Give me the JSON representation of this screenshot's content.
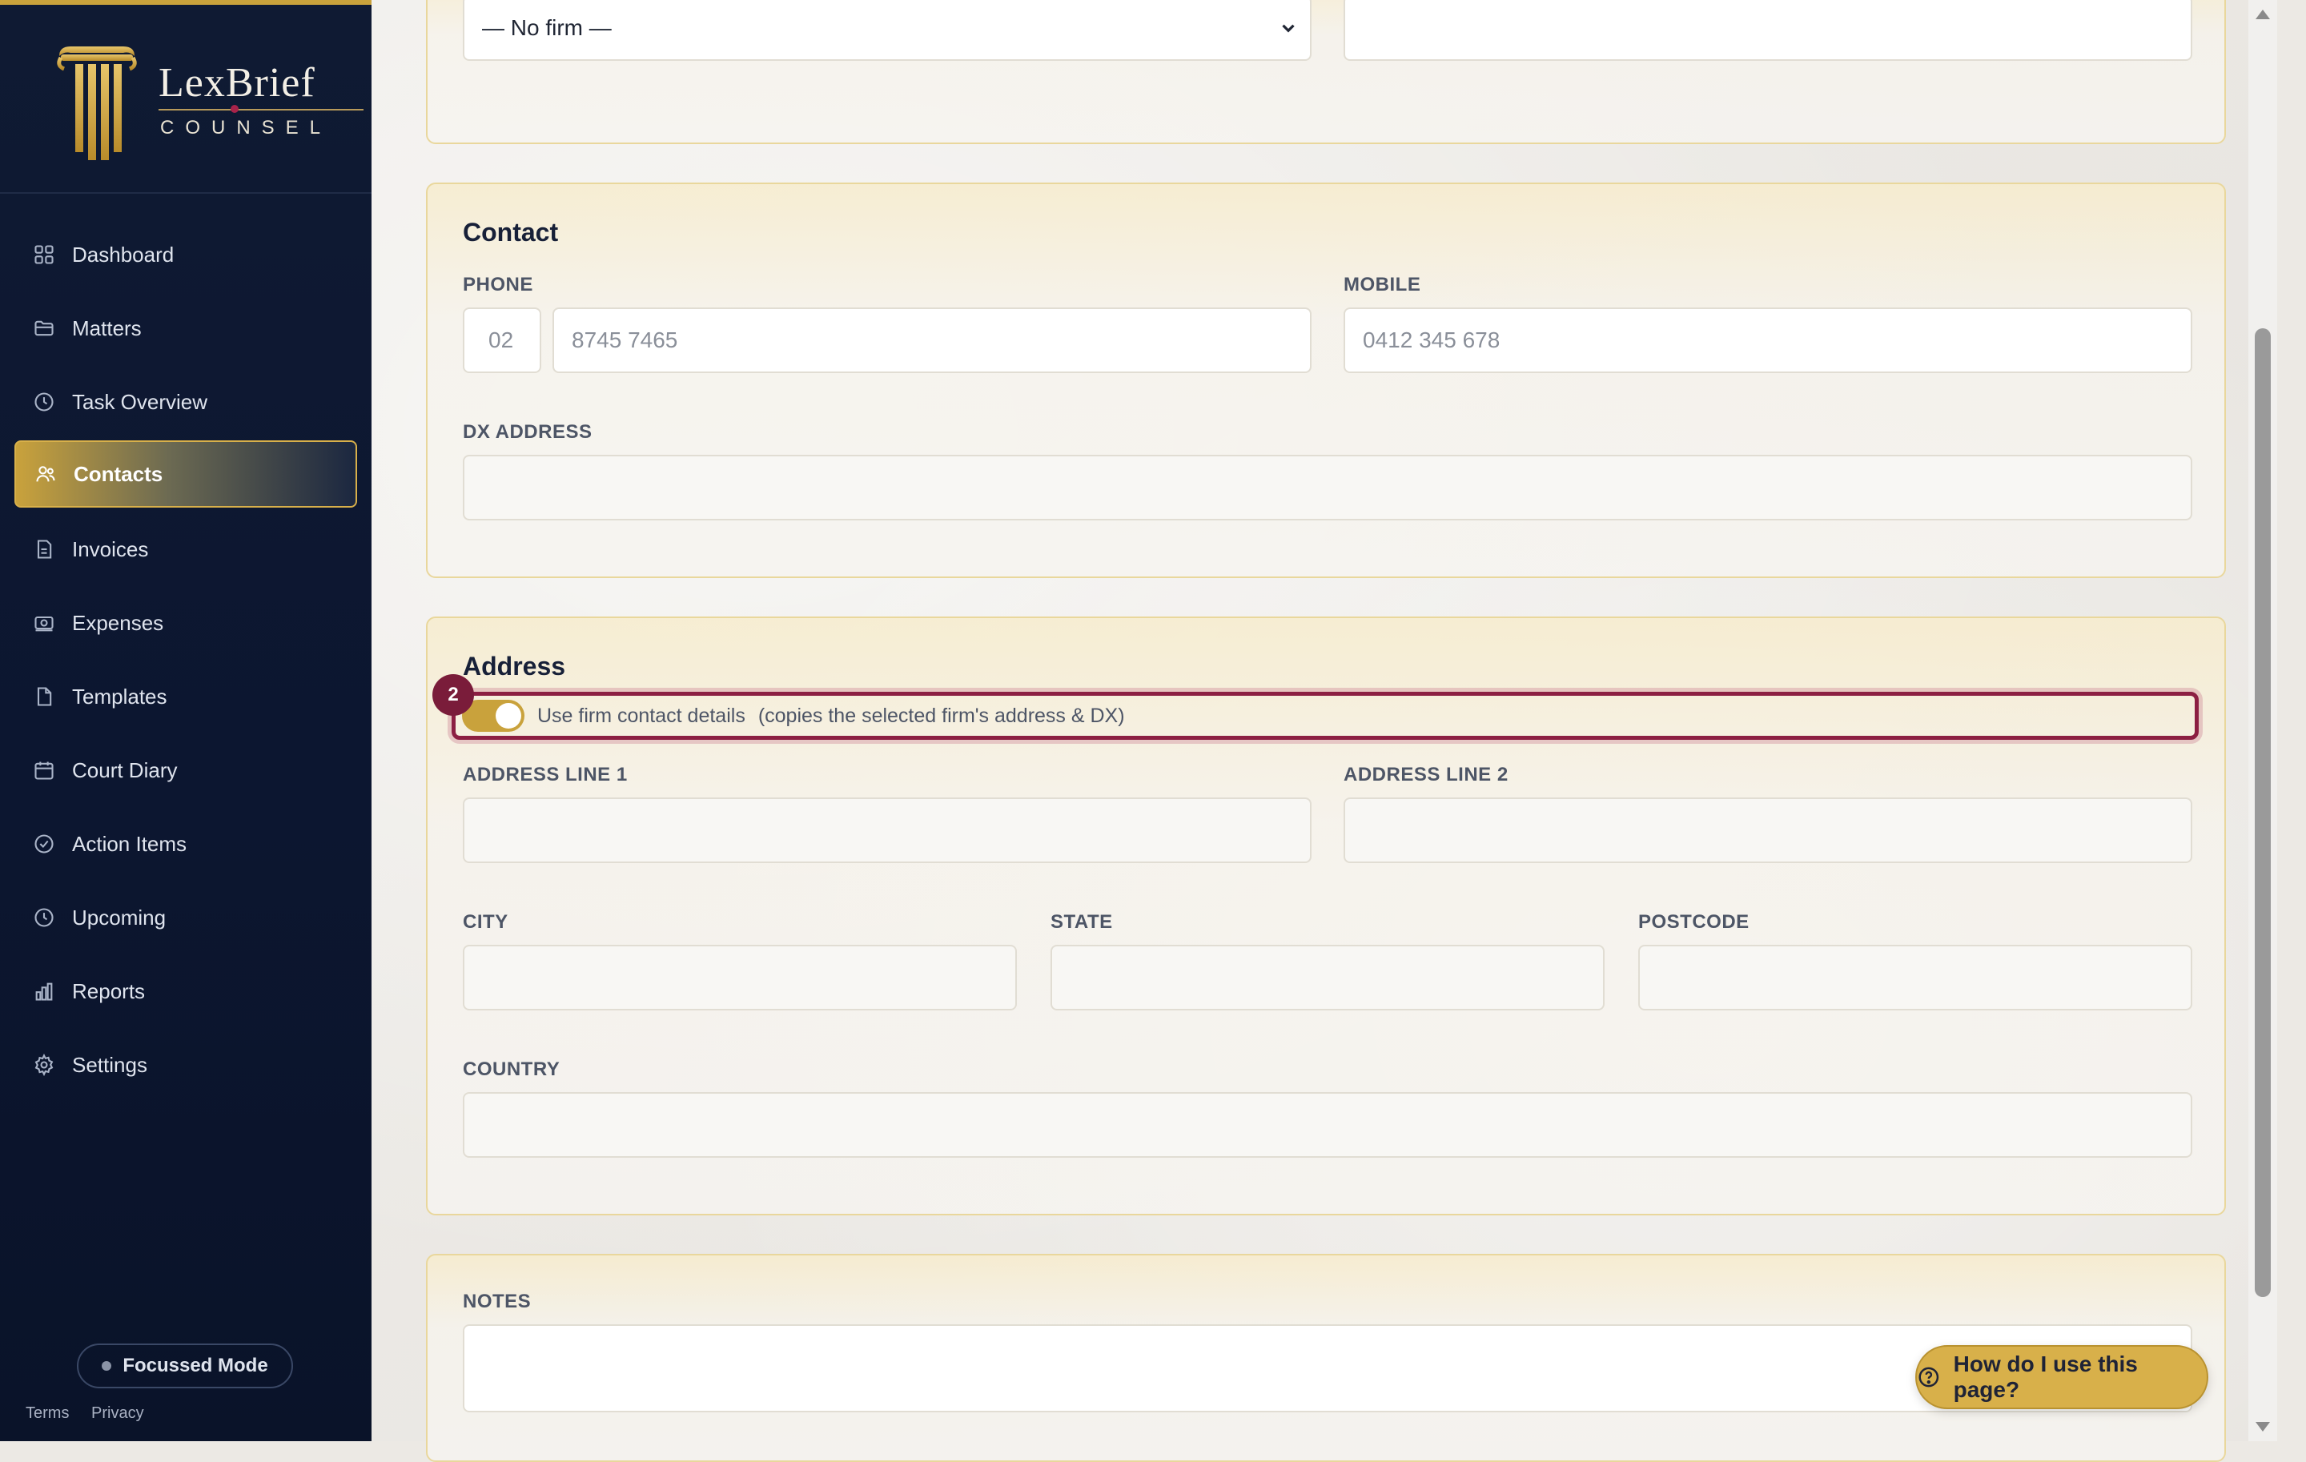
{
  "brand": {
    "name": "LexBrief",
    "sub": "COUNSEL"
  },
  "sidebar": {
    "items": [
      {
        "label": "Dashboard",
        "icon": "dashboard-icon"
      },
      {
        "label": "Matters",
        "icon": "folder-icon"
      },
      {
        "label": "Task Overview",
        "icon": "clock-icon"
      },
      {
        "label": "Contacts",
        "icon": "users-icon",
        "active": true
      },
      {
        "label": "Invoices",
        "icon": "invoice-icon"
      },
      {
        "label": "Expenses",
        "icon": "money-icon"
      },
      {
        "label": "Templates",
        "icon": "document-icon"
      },
      {
        "label": "Court Diary",
        "icon": "calendar-icon"
      },
      {
        "label": "Action Items",
        "icon": "check-circle-icon"
      },
      {
        "label": "Upcoming",
        "icon": "clock-icon"
      },
      {
        "label": "Reports",
        "icon": "bar-chart-icon"
      },
      {
        "label": "Settings",
        "icon": "gear-icon"
      }
    ],
    "focus_mode": "Focussed Mode",
    "terms": "Terms",
    "privacy": "Privacy"
  },
  "firm_section": {
    "firm_select_value": "— No firm —"
  },
  "contact": {
    "title": "Contact",
    "phone_label": "PHONE",
    "phone_area_placeholder": "02",
    "phone_number_placeholder": "8745 7465",
    "mobile_label": "MOBILE",
    "mobile_placeholder": "0412 345 678",
    "dx_label": "DX ADDRESS"
  },
  "address": {
    "title": "Address",
    "step_badge": "2",
    "toggle_label": "Use firm contact details",
    "toggle_note": "(copies the selected firm's address & DX)",
    "toggle_on": true,
    "line1_label": "ADDRESS LINE 1",
    "line2_label": "ADDRESS LINE 2",
    "city_label": "CITY",
    "state_label": "STATE",
    "postcode_label": "POSTCODE",
    "country_label": "COUNTRY"
  },
  "notes": {
    "label": "NOTES"
  },
  "help_button": "How do I use this page?",
  "colors": {
    "sidebar_bg": "#0f1a33",
    "accent_gold": "#c9a23c",
    "highlight_maroon": "#8c1f42"
  }
}
